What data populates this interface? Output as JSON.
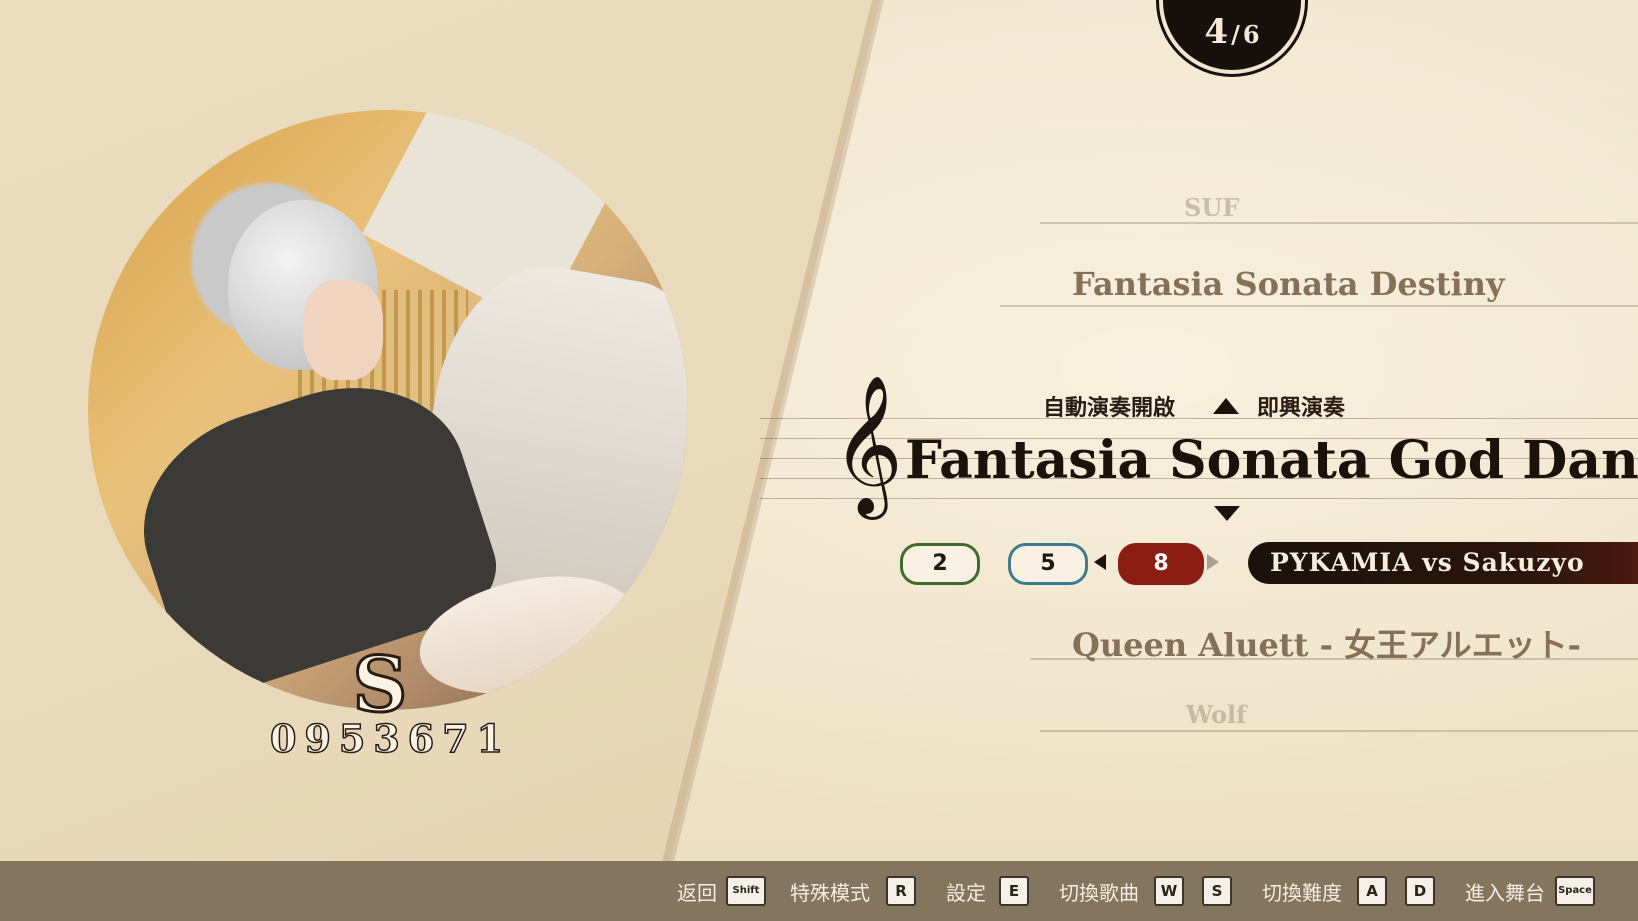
{
  "counter": {
    "current": "4",
    "separator": "/",
    "total": "6"
  },
  "result": {
    "rank": "S",
    "score": "0953671"
  },
  "song_list": {
    "far_above": "SUF",
    "near_above": "Fantasia Sonata Destiny",
    "current": "Fantasia Sonata God Dance",
    "near_below": "Queen Aluett - 女王アルエット-",
    "far_below": "Wolf"
  },
  "modes": {
    "auto_play": "自動演奏開啟",
    "improvise": "即興演奏"
  },
  "difficulties": [
    {
      "value": "2",
      "color": "#3f6c2b"
    },
    {
      "value": "5",
      "color": "#3f7b8c"
    },
    {
      "value": "8",
      "color": "#8b1d12"
    }
  ],
  "artist": "PYKAMIA vs Sakuzyo",
  "bottom_hints": [
    {
      "label": "返回",
      "keys": [
        "Shift"
      ]
    },
    {
      "label": "特殊模式",
      "keys": [
        "R"
      ]
    },
    {
      "label": "設定",
      "keys": [
        "E"
      ]
    },
    {
      "label": "切換歌曲",
      "keys": [
        "W",
        "S"
      ]
    },
    {
      "label": "切換難度",
      "keys": [
        "A",
        "D"
      ]
    },
    {
      "label": "進入舞台",
      "keys": [
        "Space"
      ]
    }
  ]
}
